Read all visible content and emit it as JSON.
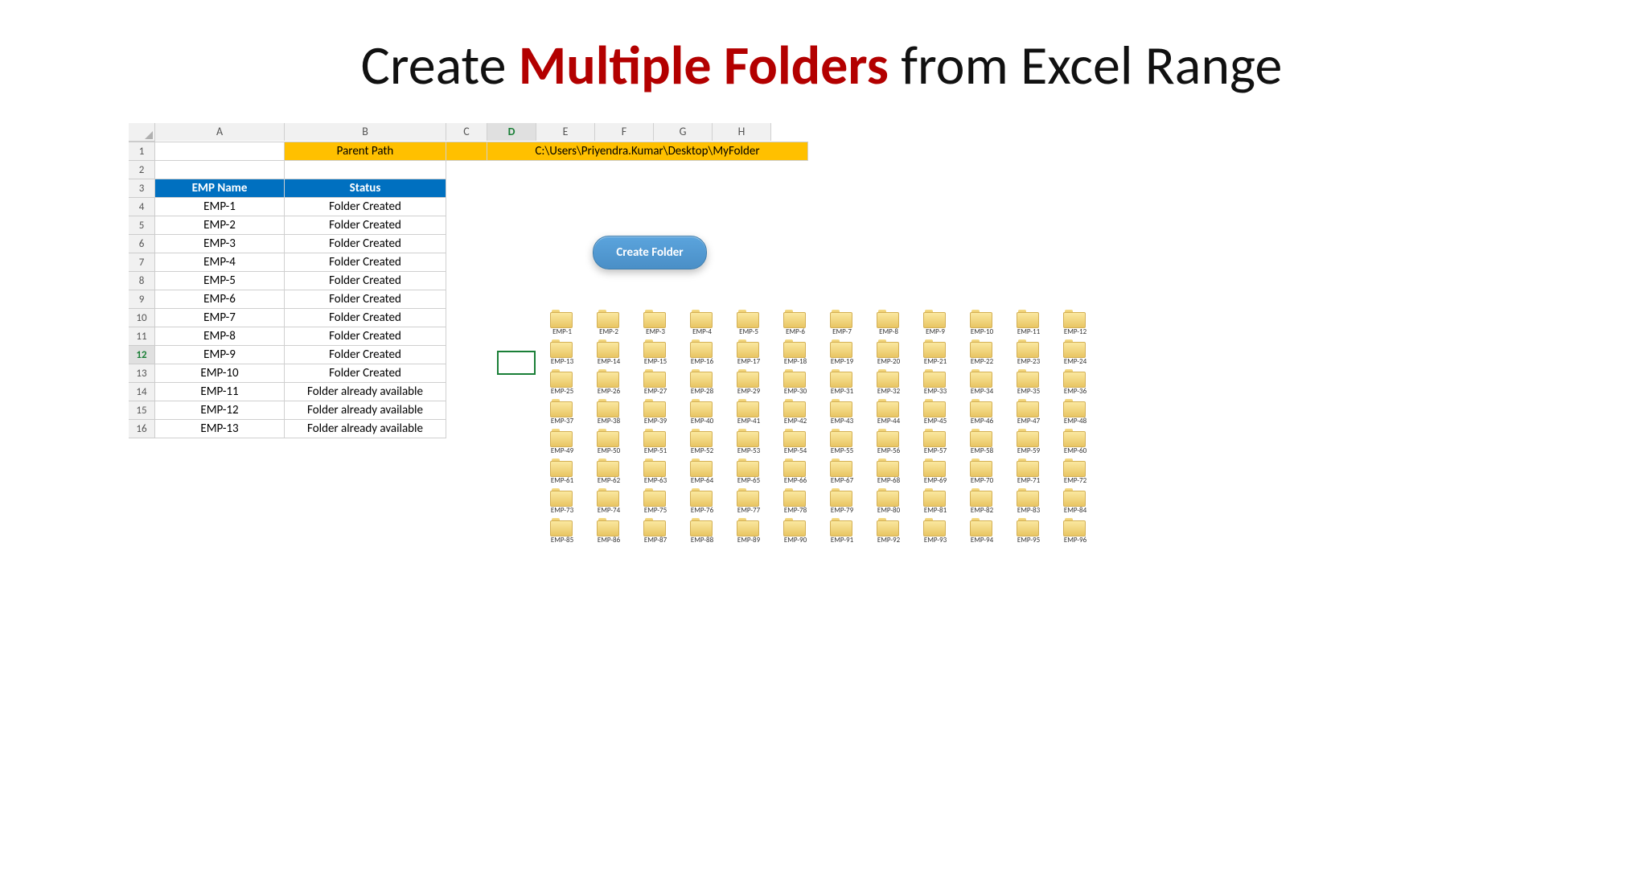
{
  "title_pre": "Create ",
  "title_highlight": "Multiple Folders",
  "title_post": " from Excel Range",
  "cols": [
    "A",
    "B",
    "C",
    "D",
    "E",
    "F",
    "G",
    "H"
  ],
  "active_col": "D",
  "row_start": 1,
  "row_end": 16,
  "active_row": 12,
  "parent_path_label": "Parent Path",
  "parent_path_value": "C:\\Users\\Priyendra.Kumar\\Desktop\\MyFolder",
  "table_headers": {
    "c1": "EMP Name",
    "c2": "Status"
  },
  "table_rows": [
    {
      "r": 4,
      "emp": "EMP-1",
      "status": "Folder Created"
    },
    {
      "r": 5,
      "emp": "EMP-2",
      "status": "Folder Created"
    },
    {
      "r": 6,
      "emp": "EMP-3",
      "status": "Folder Created"
    },
    {
      "r": 7,
      "emp": "EMP-4",
      "status": "Folder Created"
    },
    {
      "r": 8,
      "emp": "EMP-5",
      "status": "Folder Created"
    },
    {
      "r": 9,
      "emp": "EMP-6",
      "status": "Folder Created"
    },
    {
      "r": 10,
      "emp": "EMP-7",
      "status": "Folder Created"
    },
    {
      "r": 11,
      "emp": "EMP-8",
      "status": "Folder Created"
    },
    {
      "r": 12,
      "emp": "EMP-9",
      "status": "Folder Created"
    },
    {
      "r": 13,
      "emp": "EMP-10",
      "status": "Folder Created"
    },
    {
      "r": 14,
      "emp": "EMP-11",
      "status": "Folder already available"
    },
    {
      "r": 15,
      "emp": "EMP-12",
      "status": "Folder already available"
    },
    {
      "r": 16,
      "emp": "EMP-13",
      "status": "Folder already available"
    }
  ],
  "button_label": "Create Folder",
  "folder_count": 96,
  "folder_prefix": "EMP-",
  "folders_per_row": 12
}
